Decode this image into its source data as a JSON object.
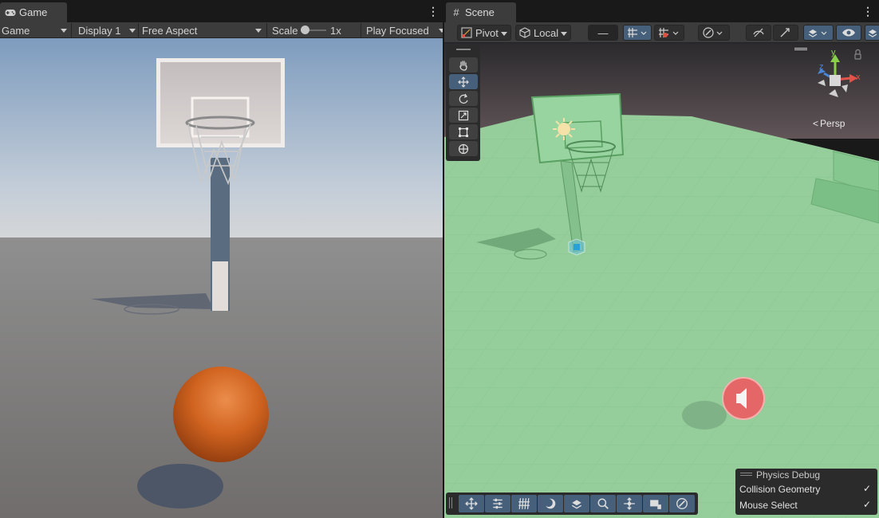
{
  "game": {
    "tab_label": "Game",
    "toolbar": {
      "mode": "Game",
      "display": "Display 1",
      "aspect": "Free Aspect",
      "scale_label": "Scale",
      "scale_value": "1x",
      "play_mode": "Play Focused"
    }
  },
  "scene": {
    "tab_label": "Scene",
    "toolbar": {
      "pivot": "Pivot",
      "space": "Local",
      "snap_value": "—"
    },
    "gizmo": {
      "y": "y",
      "x": "x",
      "z": "z",
      "projection": "Persp"
    },
    "physics_debug": {
      "title": "Physics Debug",
      "items": [
        {
          "label": "Collision Geometry",
          "checked": true
        },
        {
          "label": "Mouse Select",
          "checked": true
        }
      ]
    }
  },
  "colors": {
    "toolbar_bg": "#3c3c3c",
    "active_blue": "#46607c",
    "ball_orange": "#d2691e",
    "collider_green": "#8cd295",
    "audio_red": "#e04a4a"
  }
}
